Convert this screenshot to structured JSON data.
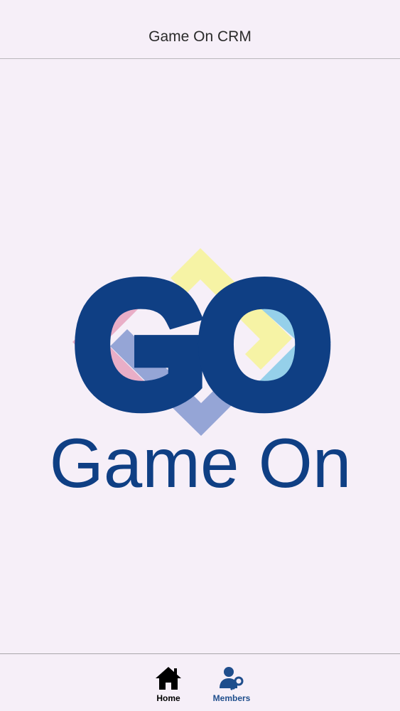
{
  "header": {
    "title": "Game On CRM"
  },
  "logo": {
    "monogram": "GO",
    "wordmark": "Game On",
    "colors": {
      "navy": "#0f3f84",
      "pink": "#e8aac4",
      "yellow": "#f6f2a0",
      "lavender": "#8fa0d4",
      "sky": "#8fcde9"
    }
  },
  "tabbar": {
    "tabs": [
      {
        "label": "Home",
        "icon": "home-icon",
        "active": false,
        "color": "#000000"
      },
      {
        "label": "Members",
        "icon": "members-icon",
        "active": true,
        "color": "#1f4e8c"
      }
    ]
  }
}
